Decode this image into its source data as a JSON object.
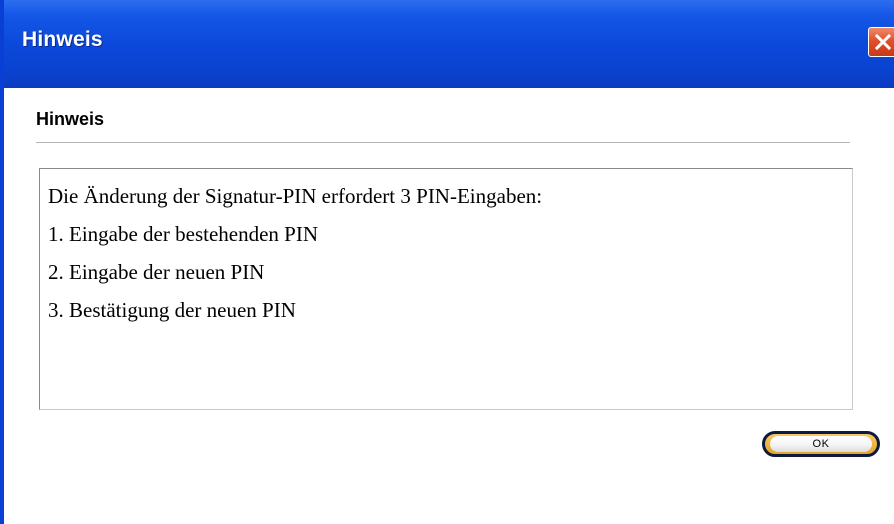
{
  "window": {
    "title": "Hinweis",
    "accent_color": "#0b47d9"
  },
  "titlebar": {
    "close_icon": "close-x-icon"
  },
  "dialog": {
    "heading": "Hinweis",
    "message_lines": [
      "Die Änderung der Signatur-PIN erfordert 3 PIN-Eingaben:",
      "1. Eingabe der bestehenden PIN",
      "2. Eingabe der neuen PIN",
      "3. Bestätigung der neuen PIN"
    ],
    "ok_label": "OK"
  }
}
